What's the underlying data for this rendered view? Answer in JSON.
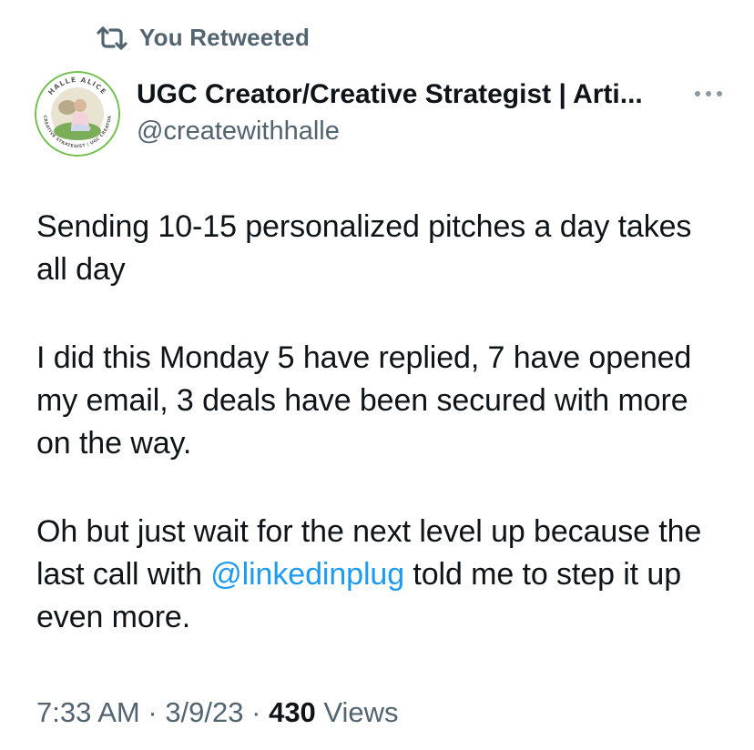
{
  "retweet": {
    "label": "You Retweeted",
    "icon": "retweet-icon"
  },
  "author": {
    "display_name": "UGC Creator/Creative Strategist | Arti...",
    "handle": "@createwithhalle",
    "avatar_ring_top_text": "HALLE ALICE",
    "avatar_ring_bottom_text": "CREATIVE STRATEGIST | UGC CREATOR"
  },
  "tweet": {
    "paragraph1": "Sending 10-15 personalized pitches a day takes all day",
    "paragraph2": "I did this Monday 5 have replied, 7 have opened my email, 3 deals have been secured with more on the way.",
    "paragraph3_before": "Oh but just wait for the next level up because the last call with ",
    "mention": "@linkedinplug",
    "paragraph3_after": " told me to step it up even more."
  },
  "meta": {
    "time": "7:33 AM",
    "separator1": " · ",
    "date": "3/9/23",
    "separator2": " · ",
    "views_count": "430",
    "views_label": " Views"
  },
  "colors": {
    "link": "#1d9bf0",
    "secondary_text": "#536471",
    "primary_text": "#0f1419",
    "avatar_ring": "#6fbf4a"
  },
  "icons": {
    "more": "more-horizontal-icon"
  }
}
